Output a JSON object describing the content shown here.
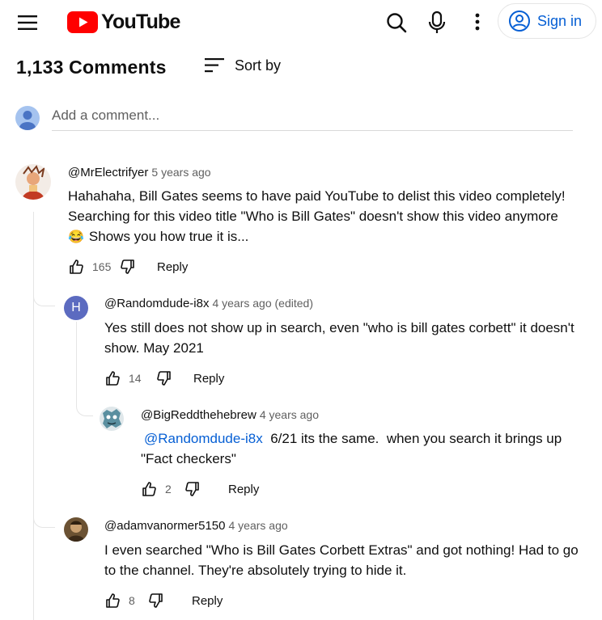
{
  "header": {
    "logo_text": "YouTube",
    "signin_label": "Sign in"
  },
  "comments_header": {
    "count_label": "1,133 Comments",
    "sort_label": "Sort by"
  },
  "add_comment": {
    "placeholder": "Add a comment..."
  },
  "comments": [
    {
      "author": "@MrElectrifyer",
      "time": "5 years ago",
      "text_lines": [
        "Hahahaha, Bill Gates seems to have paid YouTube to delist this video completely!",
        "Searching for this video title \"Who is Bill Gates\" doesn't show this video anymore",
        "Shows you how true it is..."
      ],
      "emoji": "😂",
      "likes": "165",
      "reply_label": "Reply"
    },
    {
      "author": "@Randomdude-i8x",
      "time": "4 years ago (edited)",
      "avatar_letter": "H",
      "text_lines": [
        "Yes still does not show up in search, even \"who is bill gates corbett\" it doesn't",
        "show. May 2021"
      ],
      "likes": "14",
      "reply_label": "Reply"
    },
    {
      "author": "@BigReddthehebrew",
      "time": "4 years ago",
      "mention": "@Randomdude-i8x",
      "text_lines": [
        "6/21 its the same.  when you search it brings up",
        "\"Fact checkers\""
      ],
      "likes": "2",
      "reply_label": "Reply"
    },
    {
      "author": "@adamvanormer5150",
      "time": "4 years ago",
      "text_lines": [
        "I even searched \"Who is Bill Gates Corbett Extras\" and got nothing! Had to go",
        "to the channel. They're absolutely trying to hide it."
      ],
      "likes": "8",
      "reply_label": "Reply"
    }
  ],
  "colors": {
    "brand_red": "#ff0000",
    "link_blue": "#065fd4",
    "avatar_h": "#5c6bc0"
  }
}
